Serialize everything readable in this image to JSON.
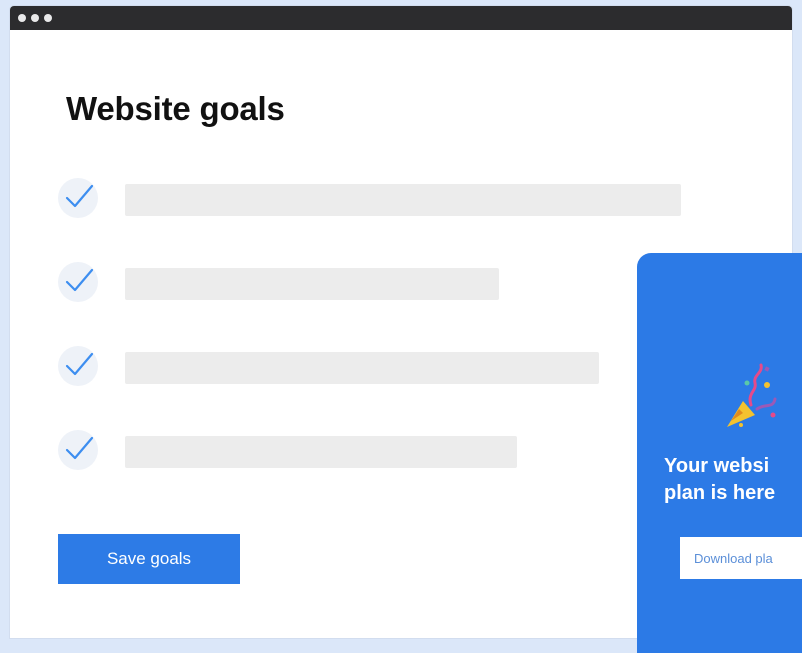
{
  "window": {
    "heading": "Website goals",
    "goals": [
      {
        "checked": true
      },
      {
        "checked": true
      },
      {
        "checked": true
      },
      {
        "checked": true
      }
    ],
    "save_label": "Save goals"
  },
  "promo": {
    "icon": "party-popper-icon",
    "title_line1": "Your websi",
    "title_line2": "plan is here",
    "download_label": "Download pla"
  },
  "colors": {
    "accent": "#2d7be6",
    "titlebar": "#2c2c2e",
    "background": "#dbe7f9",
    "placeholder": "#ececec"
  }
}
